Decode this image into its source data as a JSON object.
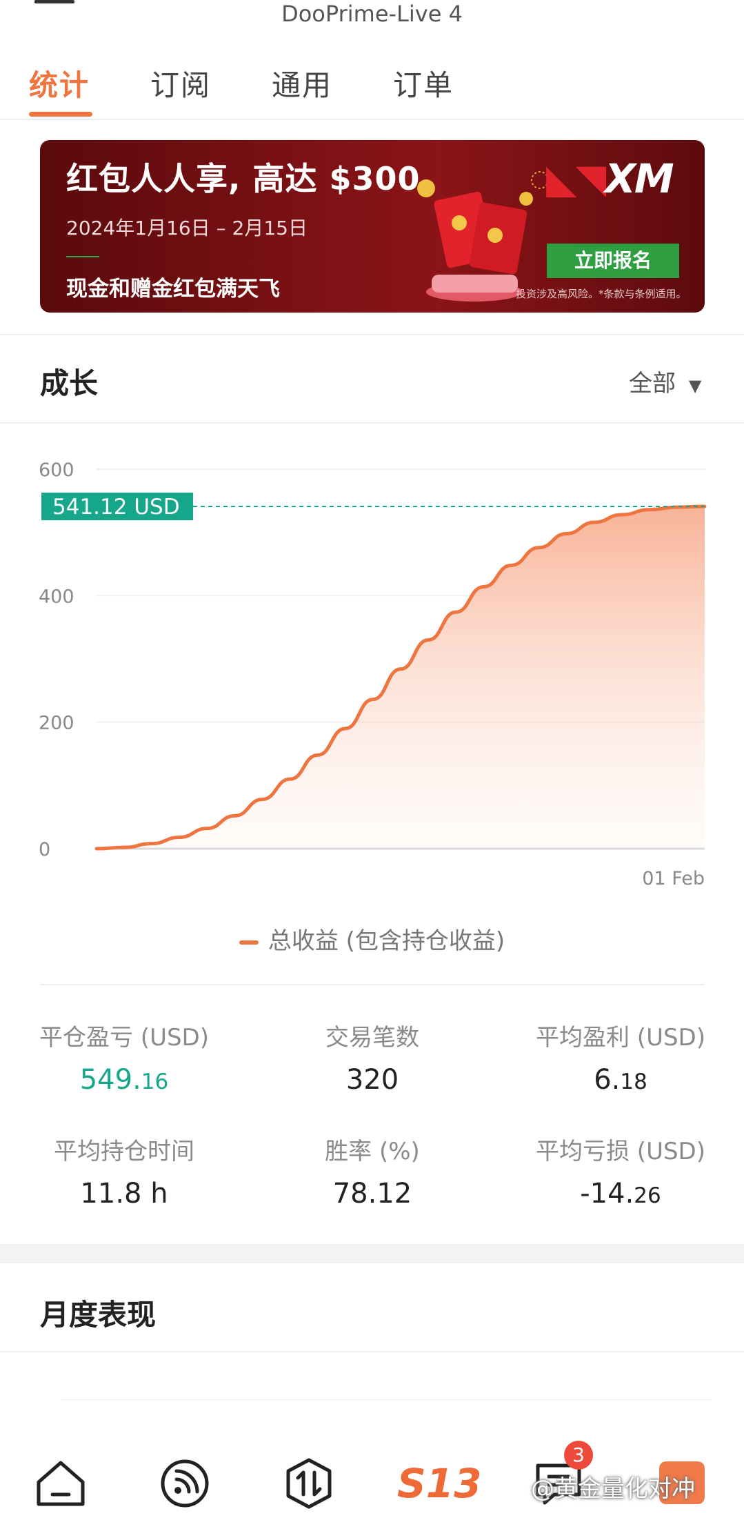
{
  "header": {
    "title": "DooPrime-Live 4"
  },
  "tabs": [
    "统计",
    "订阅",
    "通用",
    "订单"
  ],
  "banner": {
    "title": "红包人人享, 高达 $300",
    "date": "2024年1月16日 – 2月15日",
    "subtitle": "现金和赠金红包满天飞",
    "logo": "XM",
    "button": "立即报名",
    "disclaimer": "投资涉及高风险。*条款与条例适用。"
  },
  "growth": {
    "title": "成长",
    "filter": "全部"
  },
  "chart_data": {
    "type": "area",
    "y_ticks": [
      "600",
      "400",
      "200",
      "0"
    ],
    "x_tick": "01 Feb",
    "ylim": [
      0,
      600
    ],
    "current_label": "541.12 USD",
    "current_value": 541.12,
    "series": [
      {
        "name": "总收益 (包含持仓收益)",
        "values": [
          0,
          2,
          8,
          18,
          32,
          52,
          78,
          110,
          148,
          190,
          236,
          284,
          330,
          374,
          414,
          448,
          476,
          498,
          516,
          528,
          536,
          540,
          541.12
        ]
      }
    ],
    "legend": "总收益 (包含持仓收益)",
    "colors": {
      "line": "#ee7440",
      "marker": "#16a68a"
    }
  },
  "stats": [
    {
      "label": "平仓盈亏 (USD)",
      "int": "549.",
      "dec": "16",
      "color": "#16a68a"
    },
    {
      "label": "交易笔数",
      "int": "320",
      "dec": ""
    },
    {
      "label": "平均盈利 (USD)",
      "int": "6.",
      "dec": "18"
    },
    {
      "label": "平均持仓时间",
      "int": "11.8 h",
      "dec": ""
    },
    {
      "label": "胜率 (%)",
      "int": "78.12",
      "dec": ""
    },
    {
      "label": "平均亏损 (USD)",
      "int": "-14.",
      "dec": "26"
    }
  ],
  "monthly": {
    "title": "月度表现"
  },
  "nav": {
    "items": [
      "home-icon",
      "feed-icon",
      "trade-icon",
      "s13-logo",
      "message-icon",
      "profile-icon"
    ],
    "logo_text": "S13",
    "badge": "3"
  },
  "watermark": "@黄金量化对冲"
}
